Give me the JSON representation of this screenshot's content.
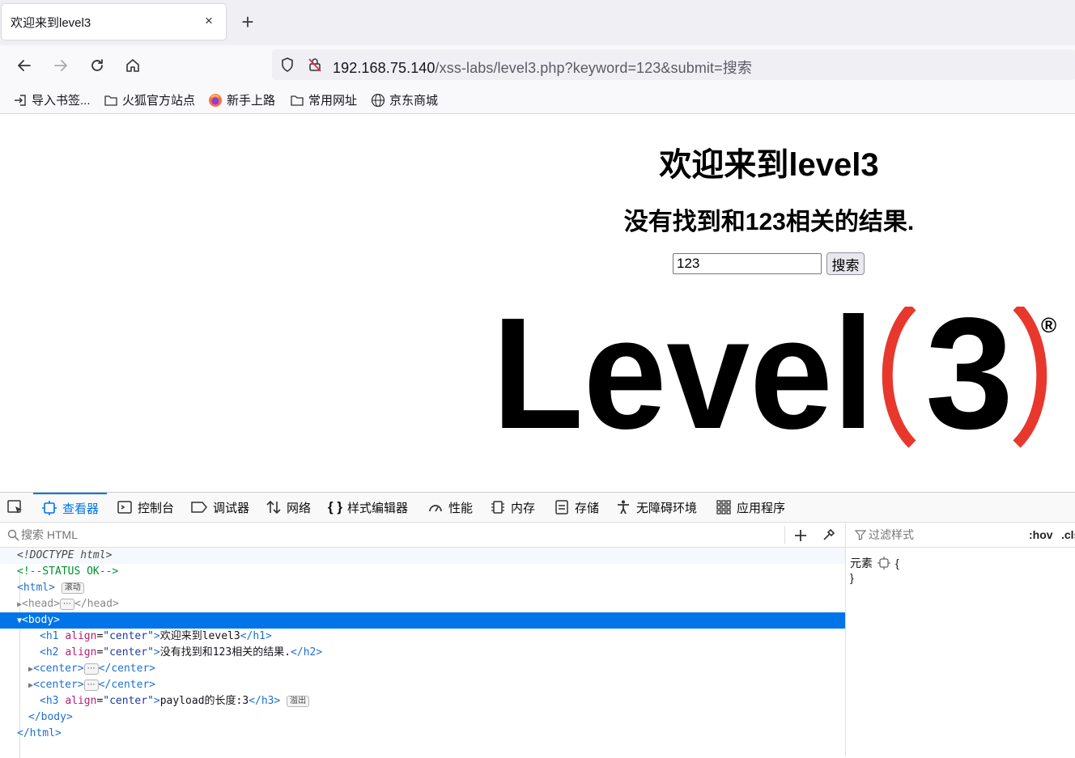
{
  "browser": {
    "tab_title": "欢迎来到level3",
    "tab_close": "×",
    "new_tab": "+",
    "url_host": "192.168.75.140",
    "url_rest": "/xss-labs/level3.php?keyword=123&submit=搜索"
  },
  "bookmarks": [
    {
      "label": "导入书签...",
      "icon": "import-icon"
    },
    {
      "label": "火狐官方站点",
      "icon": "folder-icon"
    },
    {
      "label": "新手上路",
      "icon": "firefox-icon"
    },
    {
      "label": "常用网址",
      "icon": "folder-icon"
    },
    {
      "label": "京东商城",
      "icon": "globe-icon"
    }
  ],
  "page": {
    "h1": "欢迎来到level3",
    "h2": "没有找到和123相关的结果.",
    "search_value": "123",
    "search_button": "搜索",
    "logo_text": "Level",
    "logo_num": "3",
    "logo_reg": "®"
  },
  "devtools": {
    "tabs": [
      "查看器",
      "控制台",
      "调试器",
      "网络",
      "样式编辑器",
      "性能",
      "内存",
      "存储",
      "无障碍环境",
      "应用程序"
    ],
    "search_placeholder": "搜索 HTML",
    "filter_placeholder": "过滤样式",
    "hov": ":hov",
    "cls": ".cls",
    "rule_selector": "元素",
    "rule_open": "{",
    "rule_close": "}",
    "markup": {
      "doctype": "<!DOCTYPE html>",
      "comment": "<!--STATUS OK-->",
      "html_open": "html",
      "scroll_badge": "滚动",
      "head": "head",
      "body": "body",
      "h1_attr": "align",
      "h1_val": "center",
      "h1_text": "欢迎来到level3",
      "h2_text": "没有找到和123相关的结果.",
      "center": "center",
      "h3_text": "payload的长度:3",
      "overflow_badge": "溢出",
      "ellipsis": "⋯"
    }
  }
}
